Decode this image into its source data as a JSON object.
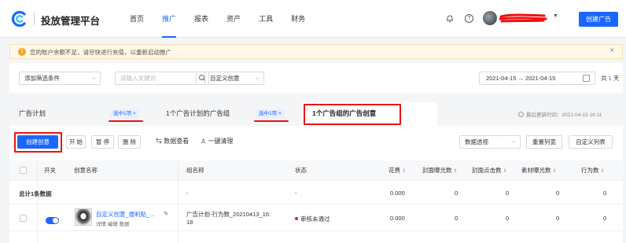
{
  "header": {
    "brand": "投放管理平台",
    "nav": [
      "首页",
      "推广",
      "报表",
      "资产",
      "工具",
      "财务"
    ],
    "active_nav": "推广",
    "create_button": "创建广告"
  },
  "notice": {
    "text": "您的账户余额不足，请尽快进行充值，以重新启动推广",
    "close": "×"
  },
  "filters": {
    "add_filter": "添加筛选条件",
    "keyword_placeholder": "请输入关键词",
    "custom_creative": "自定义创意",
    "date_range": "2021-04-15 → 2021-04-15",
    "days_prefix": "共",
    "days_count": "1",
    "days_suffix": "天"
  },
  "tabs": {
    "plan": "广告计划",
    "plan_selected": "选中1项 ×",
    "group": "1个广告计划的广告组",
    "group_selected": "选中1项 ×",
    "creative": "1个广告组的广告创意",
    "update_time": "最后更新时间：2021-04-15 16:11"
  },
  "toolbar": {
    "create": "创建创意",
    "start": "开 始",
    "pause": "暂 停",
    "delete": "删 除",
    "data_view": "数据查看",
    "clear": "一键清理",
    "perspective": "数据透视",
    "reset_width": "重置列宽",
    "custom_columns": "自定义列表"
  },
  "table": {
    "headers": {
      "switch": "开关",
      "name": "创意名称",
      "group": "组名称",
      "status": "状态",
      "cost": "花费",
      "cover_impr": "封面曝光数",
      "cover_click": "封面点击数",
      "material_impr": "素材曝光数",
      "actions": "行为数"
    },
    "total": {
      "label": "总计1条数据",
      "group": "-",
      "status": "-",
      "cost": "0.000",
      "cover_impr": "0",
      "cover_click": "0",
      "material_impr": "0",
      "actions": "0"
    },
    "row": {
      "name": "自定义创意_便利贴_...",
      "links": "详情  编辑  数据",
      "group_line1": "广告计划-行为数_20210413_16:",
      "group_line2": "18",
      "status": "审核未通过",
      "cost": "0.000",
      "cover_impr": "0",
      "cover_click": "0",
      "material_impr": "0",
      "actions": "0"
    }
  },
  "colors": {
    "accent": "#1a66ff",
    "annotation": "#e11111",
    "warning": "#f5a623"
  }
}
